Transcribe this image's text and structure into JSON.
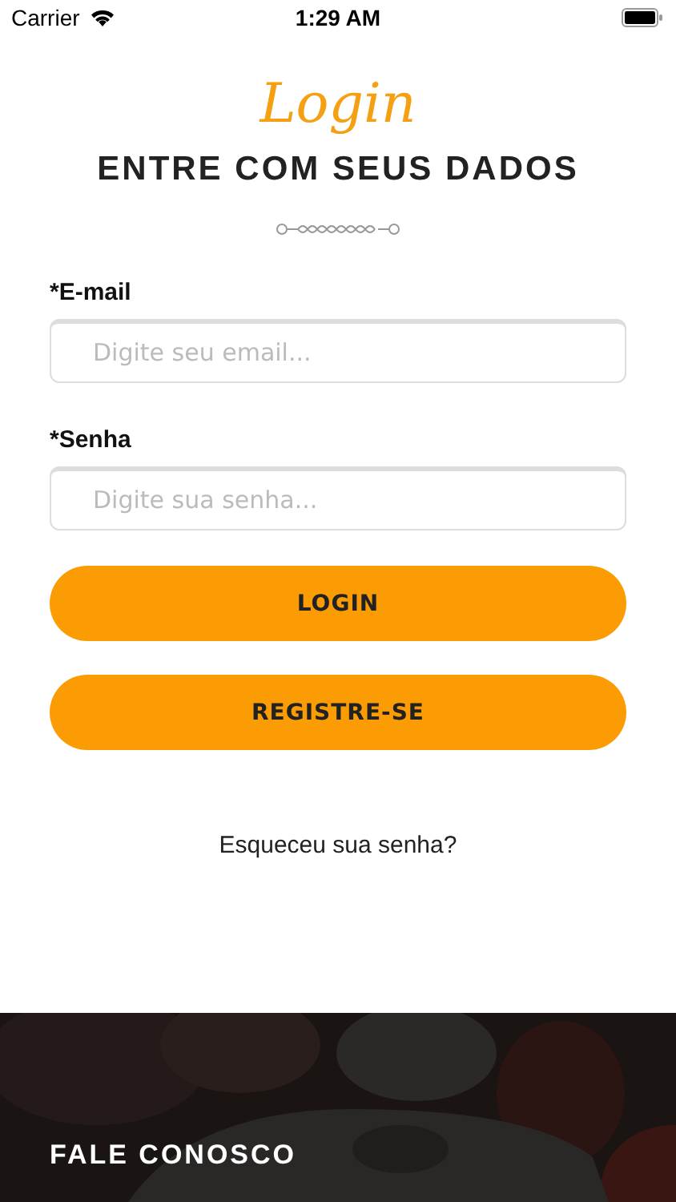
{
  "status_bar": {
    "carrier": "Carrier",
    "time": "1:29 AM"
  },
  "header": {
    "title": "Login",
    "subtitle": "ENTRE COM SEUS DADOS"
  },
  "fields": [
    {
      "label": "*E-mail",
      "placeholder": "Digite seu email..."
    },
    {
      "label": "*Senha",
      "placeholder": "Digite sua senha..."
    }
  ],
  "buttons": [
    "LOGIN",
    "REGISTRE-SE"
  ],
  "forgot_link": "Esqueceu sua senha?",
  "footer": {
    "title": "FALE CONOSCO"
  }
}
